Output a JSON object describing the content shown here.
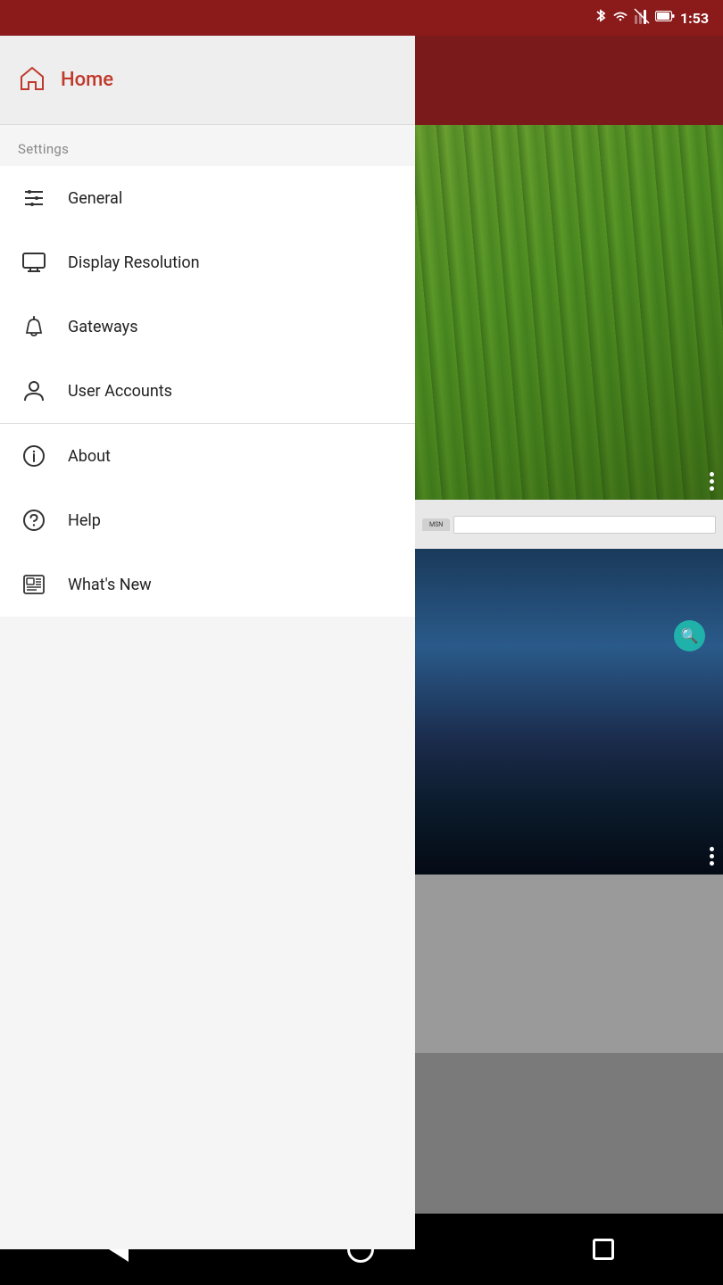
{
  "statusBar": {
    "time": "1:53",
    "icons": [
      "bluetooth",
      "wifi",
      "signal-off",
      "battery"
    ]
  },
  "appBar": {
    "addButton": "+"
  },
  "drawer": {
    "home": {
      "icon": "home",
      "label": "Home"
    },
    "settingsLabel": "Settings",
    "navItems": [
      {
        "id": "general",
        "icon": "sliders",
        "label": "General"
      },
      {
        "id": "display-resolution",
        "icon": "monitor",
        "label": "Display Resolution"
      },
      {
        "id": "gateways",
        "icon": "gateway",
        "label": "Gateways"
      },
      {
        "id": "user-accounts",
        "icon": "person",
        "label": "User Accounts"
      },
      {
        "id": "about",
        "icon": "info",
        "label": "About"
      },
      {
        "id": "help",
        "icon": "help",
        "label": "Help"
      },
      {
        "id": "whats-new",
        "icon": "newspaper",
        "label": "What's New"
      }
    ]
  },
  "navBar": {
    "back": "back",
    "home": "home",
    "recents": "recents"
  }
}
